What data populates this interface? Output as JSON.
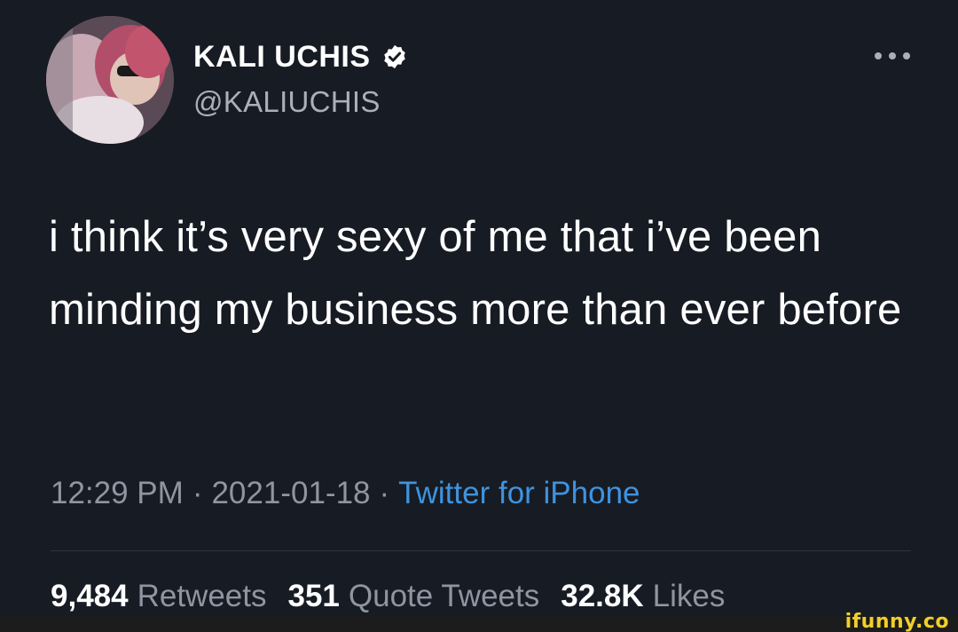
{
  "author": {
    "display_name": "KALI UCHIS",
    "handle": "@KALIUCHIS",
    "verified": true,
    "avatar_icon": "profile-photo"
  },
  "tweet": {
    "text": "i think it’s very sexy of me that i’ve been minding my business more than ever before",
    "time": "12:29 PM",
    "separator": "·",
    "date": "2021-01-18",
    "source": "Twitter for iPhone"
  },
  "stats": {
    "retweets": {
      "count": "9,484",
      "label": "Retweets"
    },
    "quote_tweets": {
      "count": "351",
      "label": "Quote Tweets"
    },
    "likes": {
      "count": "32.8K",
      "label": "Likes"
    }
  },
  "watermark": "ifunny.co",
  "colors": {
    "background": "#171b23",
    "link": "#3f93de",
    "muted": "#8e96a1",
    "watermark": "#f0cf2a"
  }
}
